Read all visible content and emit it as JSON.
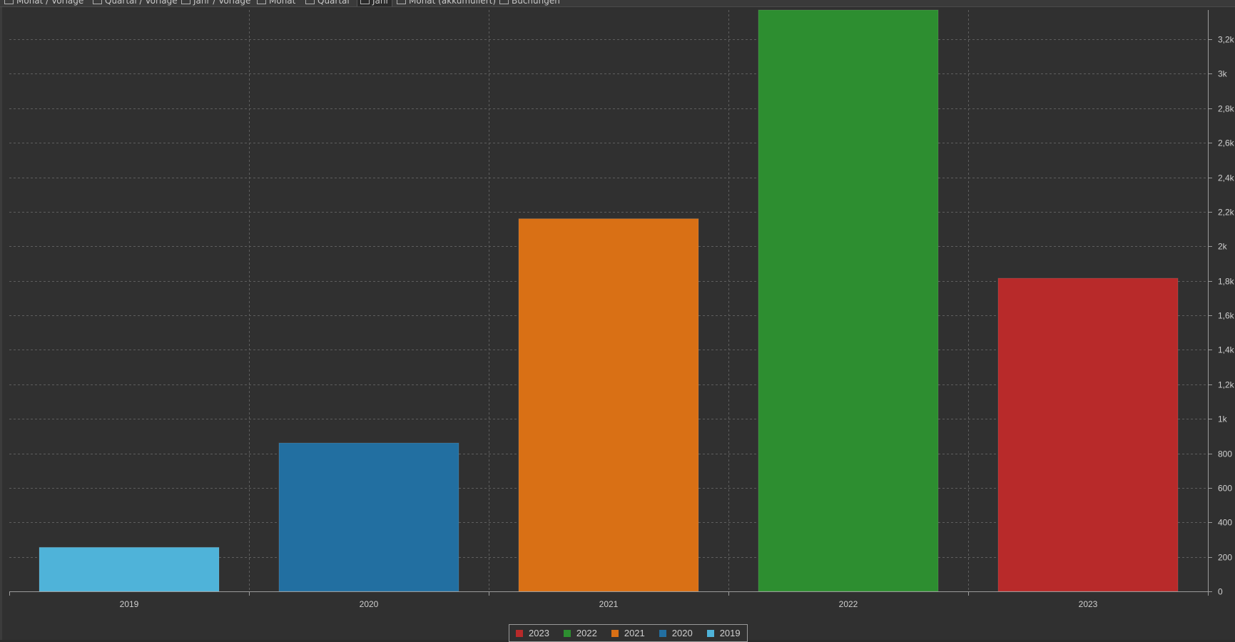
{
  "tabs": [
    {
      "label": "Monat / Vorlage",
      "icon": "table-chart-icon",
      "active": false
    },
    {
      "label": "Quartal / Vorlage",
      "icon": "table-chart-icon",
      "active": false
    },
    {
      "label": "Jahr / Vorlage",
      "icon": "table-chart-icon",
      "active": false
    },
    {
      "label": "Monat",
      "icon": "bar-chart-icon",
      "active": false
    },
    {
      "label": "Quartal",
      "icon": "bar-chart-icon",
      "active": false
    },
    {
      "label": "Jahr",
      "icon": "bar-chart-icon",
      "active": true
    },
    {
      "label": "Monat (akkumuliert)",
      "icon": "line-chart-icon",
      "active": false
    },
    {
      "label": "Buchungen",
      "icon": "table-chart-icon",
      "active": false
    }
  ],
  "chart_data": {
    "type": "bar",
    "categories": [
      "2019",
      "2020",
      "2021",
      "2022",
      "2023"
    ],
    "series": [
      {
        "name": "2019",
        "category": "2019",
        "value": 255,
        "color": "#4fb3d9"
      },
      {
        "name": "2020",
        "category": "2020",
        "value": 860,
        "color": "#226fa1"
      },
      {
        "name": "2021",
        "category": "2021",
        "value": 2160,
        "color": "#d97015"
      },
      {
        "name": "2022",
        "category": "2022",
        "value": 3370,
        "color": "#2d8e30"
      },
      {
        "name": "2023",
        "category": "2023",
        "value": 1815,
        "color": "#b82a2a"
      }
    ],
    "yaxis": {
      "position": "right",
      "ylim": [
        0,
        3370
      ],
      "ticks": [
        0,
        200,
        400,
        600,
        800,
        1000,
        1200,
        1400,
        1600,
        1800,
        2000,
        2200,
        2400,
        2600,
        2800,
        3000,
        3200
      ],
      "tick_labels": [
        "0",
        "200",
        "400",
        "600",
        "800",
        "1k",
        "1,2k",
        "1,4k",
        "1,6k",
        "1,8k",
        "2k",
        "2,2k",
        "2,4k",
        "2,6k",
        "2,8k",
        "3k",
        "3,2k"
      ]
    },
    "grid": true,
    "legend": {
      "placement": "bottom-center",
      "order": [
        "2023",
        "2022",
        "2021",
        "2020",
        "2019"
      ]
    },
    "colors": {
      "background": "#303030",
      "grid": "#5e5e5e",
      "axis": "#9a9a9a",
      "text": "#cfcfcf"
    }
  }
}
